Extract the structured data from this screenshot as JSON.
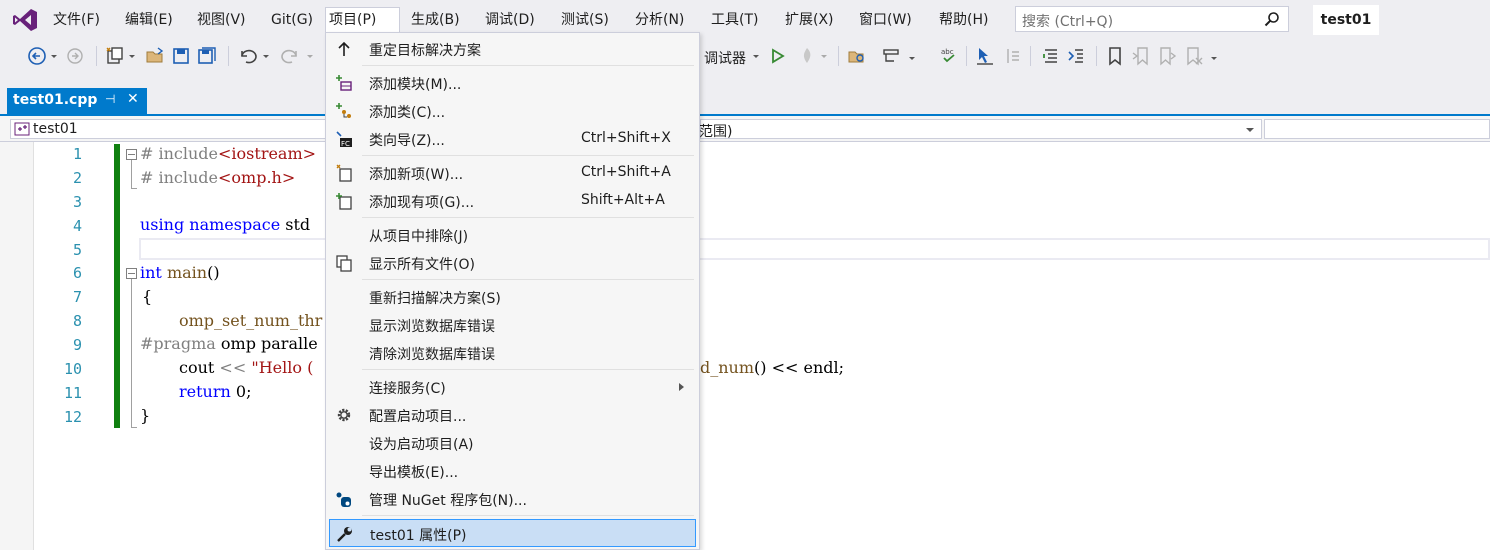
{
  "menubar": {
    "items": [
      "文件(F)",
      "编辑(E)",
      "视图(V)",
      "Git(G)",
      "项目(P)",
      "生成(B)",
      "调试(D)",
      "测试(S)",
      "分析(N)",
      "工具(T)",
      "扩展(X)",
      "窗口(W)",
      "帮助(H)"
    ],
    "search_placeholder": "搜索 (Ctrl+Q)",
    "solution_name": "test01"
  },
  "toolbar": {
    "debugger_label": "调试器"
  },
  "tabs": {
    "active_file": "test01.cpp",
    "pin_glyph": "⊣",
    "close_glyph": "✕"
  },
  "navbar": {
    "project": "test01",
    "scope": "范围)"
  },
  "editor": {
    "line_numbers": [
      "1",
      "2",
      "3",
      "4",
      "5",
      "6",
      "7",
      "8",
      "9",
      "10",
      "11",
      "12"
    ],
    "lines": {
      "l1_pp": "# include",
      "l1_str": "<iostream>",
      "l2_pp": "# include",
      "l2_str": "<omp.h>",
      "l4_kw1": "using",
      "l4_kw2": "namespace",
      "l4_rest": "std",
      "l6_kw": "int",
      "l6_fn": "main",
      "l6_rest": "()",
      "l7": "{",
      "l8": "omp_set_num_thr",
      "l9_pp": "#pragma",
      "l9_rest": "omp paralle",
      "l10_a": "cout",
      "l10_op": "<<",
      "l10_str": "\"Hello (",
      "l10_tail_fn": "d_num",
      "l10_tail_rest": "() << endl;",
      "l11_kw": "return",
      "l11_rest": "0;",
      "l12": "}"
    }
  },
  "dropdown": {
    "items": [
      {
        "label": "重定目标解决方案",
        "shortcut": "",
        "icon": "arrow-up-icon"
      },
      {
        "label": "添加模块(M)...",
        "shortcut": "",
        "icon": "add-module-icon"
      },
      {
        "label": "添加类(C)...",
        "shortcut": "",
        "icon": "add-class-icon"
      },
      {
        "label": "类向导(Z)...",
        "shortcut": "Ctrl+Shift+X",
        "icon": "class-wizard-icon"
      },
      {
        "label": "添加新项(W)...",
        "shortcut": "Ctrl+Shift+A",
        "icon": "add-new-item-icon"
      },
      {
        "label": "添加现有项(G)...",
        "shortcut": "Shift+Alt+A",
        "icon": "add-existing-item-icon"
      },
      {
        "label": "从项目中排除(J)",
        "shortcut": "",
        "icon": ""
      },
      {
        "label": "显示所有文件(O)",
        "shortcut": "",
        "icon": "show-all-files-icon"
      },
      {
        "label": "重新扫描解决方案(S)",
        "shortcut": "",
        "icon": ""
      },
      {
        "label": "显示浏览数据库错误",
        "shortcut": "",
        "icon": ""
      },
      {
        "label": "清除浏览数据库错误",
        "shortcut": "",
        "icon": ""
      },
      {
        "label": "连接服务(C)",
        "shortcut": "",
        "icon": ""
      },
      {
        "label": "配置启动项目...",
        "shortcut": "",
        "icon": "gear-icon"
      },
      {
        "label": "设为启动项目(A)",
        "shortcut": "",
        "icon": ""
      },
      {
        "label": "导出模板(E)...",
        "shortcut": "",
        "icon": ""
      },
      {
        "label": "管理 NuGet 程序包(N)...",
        "shortcut": "",
        "icon": "nuget-icon"
      },
      {
        "label": "test01 属性(P)",
        "shortcut": "",
        "icon": "wrench-icon"
      }
    ]
  },
  "colors": {
    "accent": "#007acc",
    "menu_bg": "#eeeef2",
    "selection": "#c9def5",
    "gutter_green": "#108010",
    "keyword": "#0000ff",
    "string": "#a31515"
  }
}
